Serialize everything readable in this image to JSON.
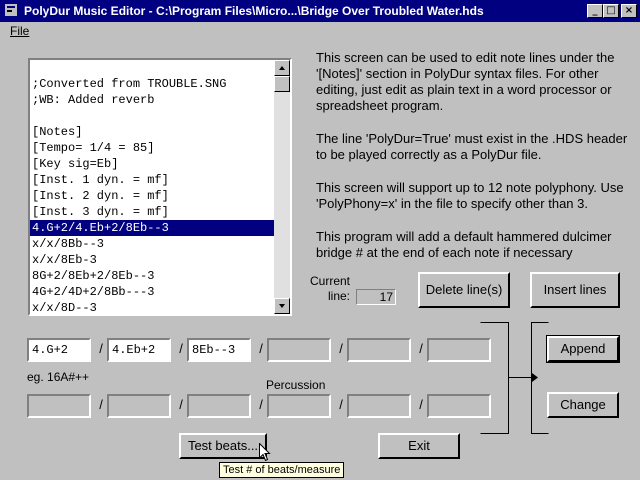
{
  "window": {
    "title": "PolyDur Music Editor - C:\\Program Files\\Micro...\\Bridge Over Troubled Water.hds",
    "minimize_label": "_",
    "maximize_label": "□",
    "close_label": "×"
  },
  "menu": {
    "file_label": "File"
  },
  "notes_list": {
    "items": [
      "",
      ";Converted from TROUBLE.SNG",
      ";WB: Added reverb",
      "",
      "[Notes]",
      "[Tempo= 1/4 = 85]",
      "[Key sig=Eb]",
      "[Inst. 1 dyn. = mf]",
      "[Inst. 2 dyn. = mf]",
      "[Inst. 3 dyn. = mf]",
      "4.G+2/4.Eb+2/8Eb--3",
      "x/x/8Bb--3",
      "x/x/8Eb-3",
      "8G+2/8Eb+2/8Eb--3",
      "4G+2/4D+2/8Bb---3",
      "x/x/8D--3"
    ],
    "selected_index": 10
  },
  "help_text": [
    "This screen can be used to edit note lines under the '[Notes]' section in PolyDur syntax files.  For other editing, just edit as plain text in a word processor or spreadsheet program.",
    "The line 'PolyDur=True' must exist in the .HDS header to be played correctly as a PolyDur file.",
    "This screen will support up to 12 note polyphony. Use 'PolyPhony=x' in the file to specify other than 3.",
    "This program will add a default hammered dulcimer bridge # at the end of each note if necessary"
  ],
  "current_line": {
    "label_line1": "Current",
    "label_line2": "line:",
    "value": "17"
  },
  "buttons": {
    "delete_line": "Delete line(s)",
    "insert_lines": "Insert lines",
    "append": "Append",
    "change": "Change",
    "test_beats": "Test beats...",
    "exit": "Exit"
  },
  "note_fields": [
    "4.G+2",
    "4.Eb+2",
    "8Eb--3",
    "",
    "",
    ""
  ],
  "percussion_fields": [
    "",
    "",
    "",
    "",
    "",
    ""
  ],
  "labels": {
    "example": "eg. 16A#++",
    "percussion": "Percussion",
    "slash": "/"
  },
  "tooltip": "Test # of beats/measure"
}
